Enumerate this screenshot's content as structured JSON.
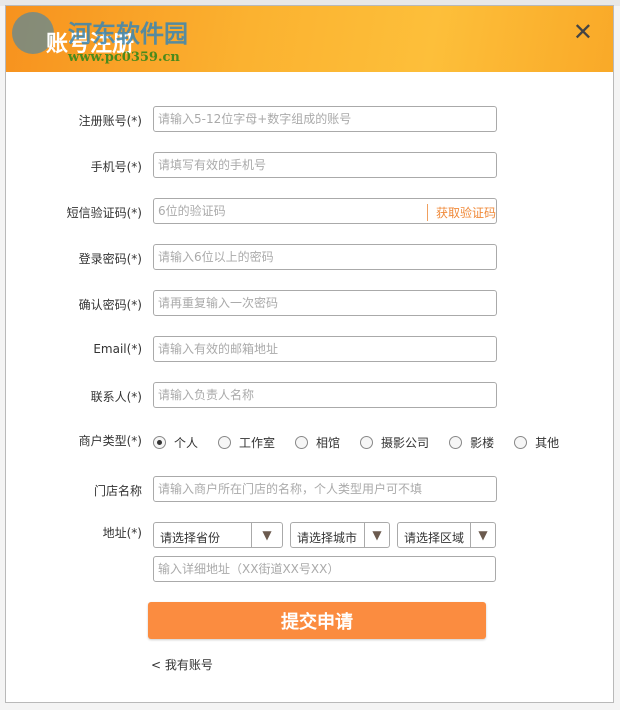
{
  "dialog": {
    "title": "账号注册",
    "watermark": "河东软件园",
    "watermark_url": "www.pc0359.cn",
    "close_label": "✕"
  },
  "fields": [
    {
      "label": "注册账号(*)",
      "placeholder": "请输入5-12位字母+数字组成的账号"
    },
    {
      "label": "手机号(*)",
      "placeholder": "请填写有效的手机号"
    },
    {
      "label": "短信验证码(*)",
      "placeholder": "6位的验证码",
      "action": "获取验证码"
    },
    {
      "label": "登录密码(*)",
      "placeholder": "请输入6位以上的密码"
    },
    {
      "label": "确认密码(*)",
      "placeholder": "请再重复输入一次密码"
    },
    {
      "label": "Email(*)",
      "placeholder": "请输入有效的邮箱地址"
    },
    {
      "label": "联系人(*)",
      "placeholder": "请输入负责人名称"
    }
  ],
  "merchant_type": {
    "label": "商户类型(*)",
    "options": [
      "个人",
      "工作室",
      "相馆",
      "摄影公司",
      "影楼",
      "其他"
    ],
    "selected": "个人"
  },
  "store": {
    "label": "门店名称",
    "placeholder": "请输入商户所在门店的名称，个人类型用户可不填"
  },
  "address": {
    "label": "地址(*)",
    "province": "请选择省份",
    "city": "请选择城市",
    "district": "请选择区域",
    "detail_placeholder": "输入详细地址（XX街道XX号XX）"
  },
  "submit_label": "提交申请",
  "have_account": "< 我有账号"
}
